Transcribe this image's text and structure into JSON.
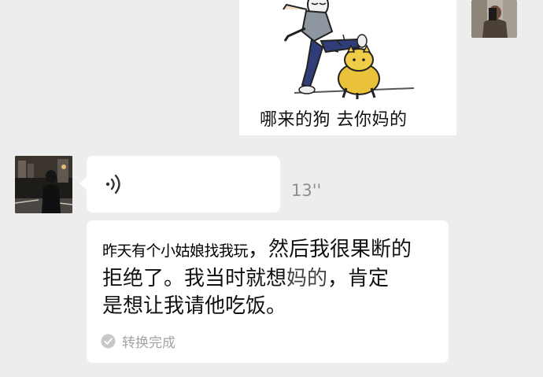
{
  "sticker": {
    "caption": "哪来的狗 去你妈的",
    "icon": "meme-kick-dog-image"
  },
  "voice_message": {
    "duration": "13''",
    "icon": "voice-wave-icon"
  },
  "transcript": {
    "overlay_text": "昨天有个小姑娘找我玩",
    "line_1_rest": "，然后我很果断的",
    "line_2_a": "拒绝了。我当时就想",
    "line_2_garble": "妈的",
    "line_2_b": "，肯定",
    "line_3": "是想让我请他吃饭。",
    "status_label": "转换完成",
    "status_icon": "check-circle-icon"
  },
  "avatars": {
    "me": "avatar-selfie",
    "friend": "avatar-night-street"
  },
  "colors": {
    "background": "#ededed",
    "bubble": "#ffffff",
    "secondary_text": "#8f8f8f",
    "status_text": "#a3a3a3"
  }
}
